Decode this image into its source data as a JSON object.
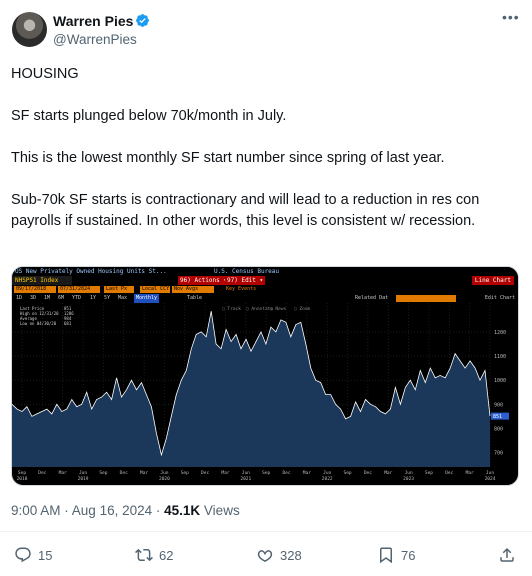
{
  "author": {
    "display_name": "Warren Pies",
    "handle": "@WarrenPies",
    "verified": true
  },
  "tweet": {
    "paragraphs": [
      "HOUSING",
      "SF starts plunged below 70k/month in July.",
      "This is the lowest monthly SF start number since spring of last year.",
      "Sub-70k SF starts is contractionary and will lead to a reduction in res con payrolls if sustained. In other words, this level is consistent w/ recession."
    ]
  },
  "chart_header": {
    "title": "US New Privately Owned Housing Units St...",
    "source": "U.S. Census Bureau",
    "ticker": "NHSPS1 Index",
    "actions_label": "Actions",
    "edit_label": "Edit",
    "key_events_label": "Key Events",
    "line_chart_label": "Line Chart",
    "date_start": "09/17/2018",
    "date_end": "07/31/2024",
    "px_label": "Last Px",
    "local_ccy": "Local CCY",
    "no_avgs": "Nov Avgs",
    "timeframes": [
      "1D",
      "3D",
      "1M",
      "6M",
      "YTD",
      "1Y",
      "5Y",
      "Max",
      "Monthly"
    ],
    "table_label": "Table",
    "related_data_label": "Related Dat",
    "edit_chart_label": "Edit Chart",
    "toolbar_items": [
      "Track",
      "Annotate",
      "News",
      "Zoom"
    ]
  },
  "chart_data": {
    "type": "area",
    "legend": [
      {
        "label": "Last Price",
        "value": "851"
      },
      {
        "label": "High on 12/31/20",
        "value": "1286"
      },
      {
        "label": "Average",
        "value": "984"
      },
      {
        "label": "Low on 04/30/20",
        "value": "681"
      }
    ],
    "y_ticks": [
      700,
      800,
      900,
      1000,
      1100,
      1200
    ],
    "ylim": [
      640,
      1320
    ],
    "last_value": "851",
    "x_tick_labels": [
      [
        "Sep",
        "2018"
      ],
      [
        "Dec",
        ""
      ],
      [
        "Mar",
        ""
      ],
      [
        "Jun",
        "2019"
      ],
      [
        "Sep",
        ""
      ],
      [
        "Dec",
        ""
      ],
      [
        "Mar",
        ""
      ],
      [
        "Jun",
        "2020"
      ],
      [
        "Sep",
        ""
      ],
      [
        "Dec",
        ""
      ],
      [
        "Mar",
        ""
      ],
      [
        "Jun",
        "2021"
      ],
      [
        "Sep",
        ""
      ],
      [
        "Dec",
        ""
      ],
      [
        "Mar",
        ""
      ],
      [
        "Jun",
        "2022"
      ],
      [
        "Sep",
        ""
      ],
      [
        "Dec",
        ""
      ],
      [
        "Mar",
        ""
      ],
      [
        "Jun",
        "2023"
      ],
      [
        "Sep",
        ""
      ],
      [
        "Dec",
        ""
      ],
      [
        "Mar",
        ""
      ],
      [
        "Jun",
        "2024"
      ]
    ],
    "values": [
      900,
      880,
      870,
      890,
      850,
      860,
      870,
      880,
      860,
      900,
      870,
      880,
      920,
      890,
      900,
      950,
      880,
      920,
      930,
      950,
      920,
      1010,
      930,
      960,
      1000,
      960,
      990,
      940,
      890,
      780,
      690,
      760,
      850,
      940,
      1000,
      1040,
      1130,
      1190,
      1200,
      1180,
      1286,
      1150,
      1130,
      1210,
      1160,
      1190,
      1130,
      1170,
      1120,
      1160,
      1200,
      1150,
      1220,
      1200,
      1250,
      1240,
      1180,
      1230,
      1240,
      1150,
      1050,
      1000,
      990,
      940,
      940,
      900,
      880,
      840,
      850,
      910,
      870,
      920,
      900,
      890,
      870,
      860,
      880,
      970,
      900,
      970,
      1000,
      960,
      1040,
      990,
      1050,
      1010,
      1020,
      1010,
      1050,
      1110,
      1080,
      1050,
      1080,
      1050,
      1000,
      1040,
      851
    ],
    "colors": {
      "area": "#1c3a5e",
      "line": "#ffffff",
      "last_tag": "#2b5fd0"
    }
  },
  "footer": {
    "time": "9:00 AM",
    "date": "Aug 16, 2024",
    "views_count": "45.1K",
    "views_label": "Views",
    "replies": "15",
    "reposts": "62",
    "likes": "328",
    "bookmarks": "76"
  }
}
